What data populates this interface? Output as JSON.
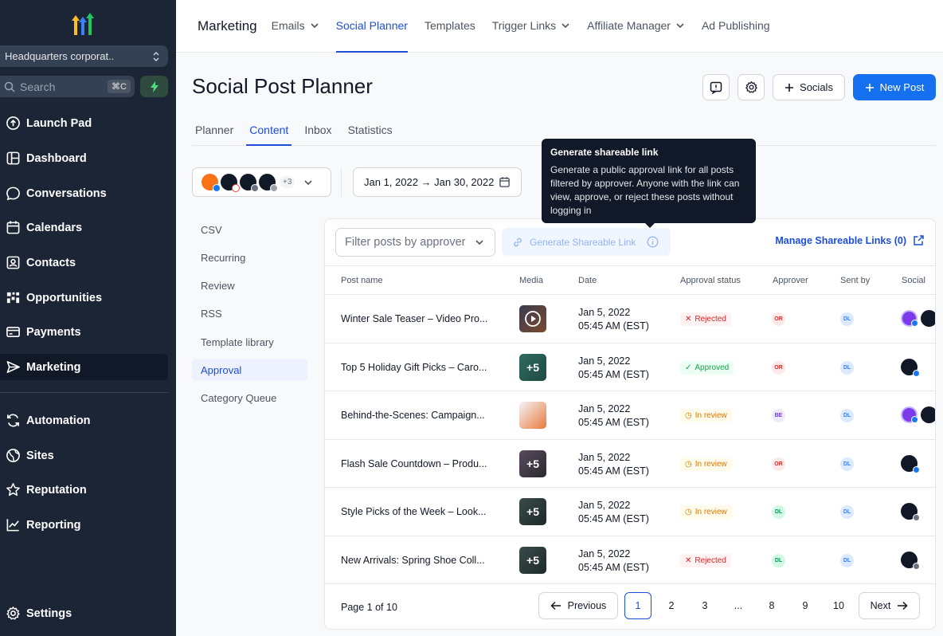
{
  "sidebar": {
    "location": "Headquarters corporat..",
    "search_placeholder": "Search",
    "search_shortcut": "⌘C",
    "items": [
      {
        "label": "Launch Pad",
        "icon": "rocket-circle-icon"
      },
      {
        "label": "Dashboard",
        "icon": "dashboard-icon"
      },
      {
        "label": "Conversations",
        "icon": "chat-icon"
      },
      {
        "label": "Calendars",
        "icon": "calendar-icon"
      },
      {
        "label": "Contacts",
        "icon": "contacts-icon"
      },
      {
        "label": "Opportunities",
        "icon": "opportunities-icon"
      },
      {
        "label": "Payments",
        "icon": "payments-icon"
      },
      {
        "label": "Marketing",
        "icon": "send-icon"
      },
      {
        "label": "Automation",
        "icon": "automation-icon"
      },
      {
        "label": "Sites",
        "icon": "globe-icon"
      },
      {
        "label": "Reputation",
        "icon": "star-icon"
      },
      {
        "label": "Reporting",
        "icon": "chart-line-icon"
      },
      {
        "label": "Settings",
        "icon": "gear-icon"
      }
    ]
  },
  "topnav": {
    "title": "Marketing",
    "tabs": [
      {
        "label": "Emails",
        "dropdown": true
      },
      {
        "label": "Social Planner",
        "dropdown": false
      },
      {
        "label": "Templates",
        "dropdown": false
      },
      {
        "label": "Trigger Links",
        "dropdown": true
      },
      {
        "label": "Affiliate Manager",
        "dropdown": true
      },
      {
        "label": "Ad Publishing",
        "dropdown": false
      }
    ]
  },
  "page": {
    "title": "Social Post Planner",
    "socials_label": "Socials",
    "new_post_label": "New Post",
    "subtabs": [
      "Planner",
      "Content",
      "Inbox",
      "Statistics"
    ],
    "accounts_more": "+3",
    "date_range": "Jan 1, 2022 → Jan 30, 2022"
  },
  "submenu": [
    "CSV",
    "Recurring",
    "Review",
    "RSS",
    "Template library",
    "Approval",
    "Category Queue"
  ],
  "table": {
    "approver_placeholder": "Filter posts by approver",
    "generate_label": "Generate Shareable Link",
    "manage_label": "Manage Shareable Links (0)",
    "headers": {
      "post_name": "Post name",
      "media": "Media",
      "date": "Date",
      "status": "Approval status",
      "approver": "Approver",
      "sent_by": "Sent by",
      "social": "Social"
    },
    "rows": [
      {
        "name": "Winter Sale Teaser – Video Pro...",
        "media": "",
        "date": "Jan 5, 2022",
        "time": "05:45 AM (EST)",
        "status": "Rejected",
        "approver": "OR",
        "sent_by": "DL"
      },
      {
        "name": "Top 5 Holiday Gift Picks – Caro...",
        "media": "+5",
        "date": "Jan 5, 2022",
        "time": "05:45 AM (EST)",
        "status": "Approved",
        "approver": "OR",
        "sent_by": "DL"
      },
      {
        "name": "Behind-the-Scenes: Campaign...",
        "media": "",
        "date": "Jan 5, 2022",
        "time": "05:45 AM (EST)",
        "status": "In review",
        "approver": "BE",
        "sent_by": "DL"
      },
      {
        "name": "Flash Sale Countdown – Produ...",
        "media": "+5",
        "date": "Jan 5, 2022",
        "time": "05:45 AM (EST)",
        "status": "In review",
        "approver": "OR",
        "sent_by": "DL"
      },
      {
        "name": "Style Picks of the Week – Look...",
        "media": "+5",
        "date": "Jan 5, 2022",
        "time": "05:45 AM (EST)",
        "status": "In review",
        "approver": "DL",
        "sent_by": "DL"
      },
      {
        "name": "New Arrivals: Spring Shoe Coll...",
        "media": "+5",
        "date": "Jan 5, 2022",
        "time": "05:45 AM (EST)",
        "status": "Rejected",
        "approver": "DL",
        "sent_by": "DL"
      }
    ],
    "pagination": {
      "info": "Page 1 of 10",
      "previous": "Previous",
      "next": "Next",
      "pages": [
        "1",
        "2",
        "3",
        "...",
        "8",
        "9",
        "10"
      ]
    }
  },
  "tooltip": {
    "title": "Generate shareable link",
    "body": "Generate a public approval link for all posts filtered by approver. Anyone with the link can view, approve, or reject these posts without logging in"
  },
  "colors": {
    "primary": "#1570ef",
    "sidebar": "#1c2536",
    "rejected": "#dc2626",
    "approved": "#16a34a",
    "review": "#d97706"
  }
}
